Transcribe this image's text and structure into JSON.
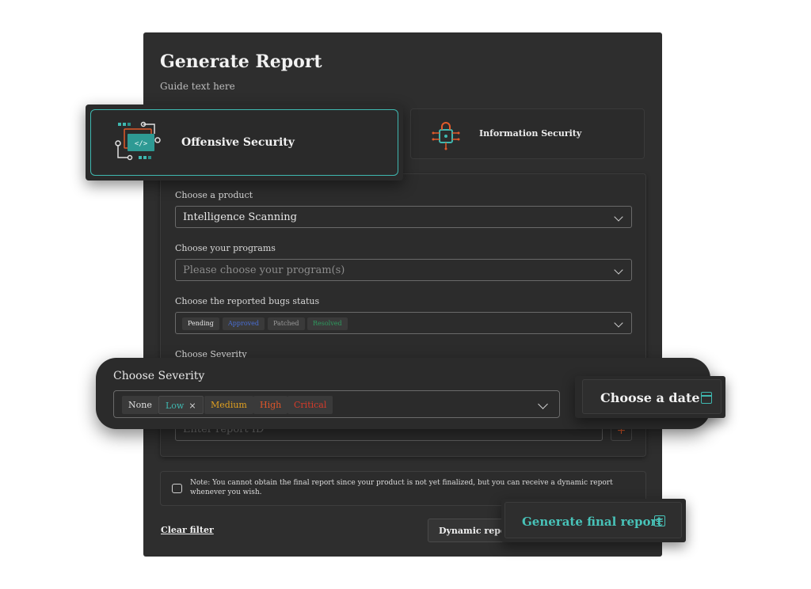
{
  "header": {
    "title": "Generate Report",
    "guide": "Guide text here"
  },
  "categories": {
    "offensive": {
      "label": "Offensive Security",
      "selected": true
    },
    "information": {
      "label": "Information Security",
      "selected": false
    }
  },
  "form": {
    "product": {
      "label": "Choose a product",
      "value": "Intelligence Scanning"
    },
    "programs": {
      "label": "Choose your programs",
      "placeholder": "Please choose your program(s)"
    },
    "bugs_status": {
      "label": "Choose the reported bugs status",
      "chips": [
        {
          "label": "Pending",
          "color": "#e8e8e8"
        },
        {
          "label": "Approved",
          "color": "#4a6fd6"
        },
        {
          "label": "Patched",
          "color": "#9a9a9a"
        },
        {
          "label": "Resolved",
          "color": "#2e9a5e"
        }
      ]
    },
    "severity_label_behind": "Choose Severity",
    "report_id": {
      "placeholder": "Enter report ID",
      "add_label": "+"
    }
  },
  "severity": {
    "label": "Choose Severity",
    "chips": [
      {
        "label": "None",
        "color": "#e0e0e0"
      },
      {
        "label": "Low",
        "color": "#3fb8b0",
        "removable": true,
        "remove_symbol": "×"
      },
      {
        "label": "Medium",
        "color": "#e0a020"
      },
      {
        "label": "High",
        "color": "#e0562a"
      },
      {
        "label": "Critical",
        "color": "#d63a2a"
      }
    ]
  },
  "date": {
    "label": "Choose a date"
  },
  "note": {
    "text": "Note: You cannot obtain the final report since your product is not yet finalized, but you can receive a dynamic report whenever you wish."
  },
  "actions": {
    "clear": "Clear filter",
    "dynamic": "Dynamic report",
    "generate": "Generate  final report"
  },
  "colors": {
    "accent": "#3fb8b0",
    "panel": "#2e2e2e"
  }
}
